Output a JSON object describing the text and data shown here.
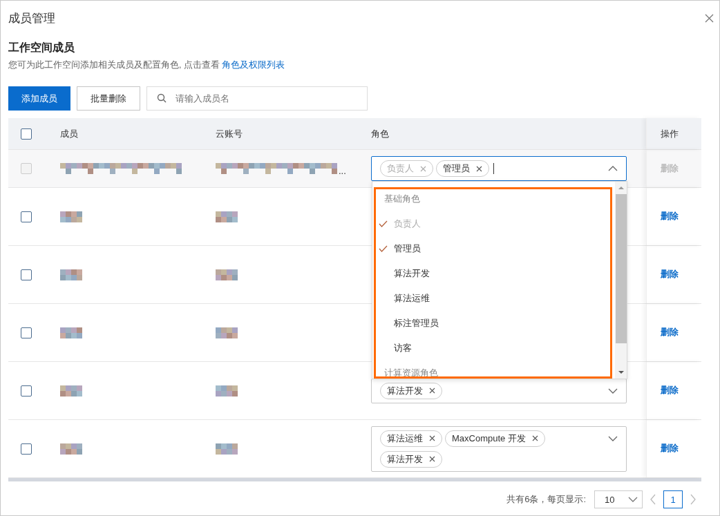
{
  "dialog": {
    "title": "成员管理"
  },
  "section": {
    "title": "工作空间成员",
    "description": "您可为此工作空间添加相关成员及配置角色, 点击查看 ",
    "link": "角色及权限列表"
  },
  "toolbar": {
    "buttons": [
      {
        "label": "添加成员",
        "kind": "primary"
      },
      {
        "label": "批量删除",
        "kind": "default"
      }
    ],
    "search": {
      "placeholder": "请输入成员名"
    }
  },
  "table": {
    "columns": [
      "成员",
      "云账号",
      "角色",
      "操作"
    ],
    "header_checked": false,
    "rows": [
      {
        "checked": false,
        "disabled": true,
        "account_suffix": "...",
        "expanded": true,
        "roles": [
          {
            "label": "负责人",
            "disabled": true
          },
          {
            "label": "管理员",
            "disabled": false
          }
        ],
        "action": "删除",
        "action_disabled": true
      },
      {
        "checked": false,
        "disabled": false,
        "action": "删除",
        "action_disabled": false
      },
      {
        "checked": false,
        "disabled": false,
        "action": "删除",
        "action_disabled": false
      },
      {
        "checked": false,
        "disabled": false,
        "action": "删除",
        "action_disabled": false
      },
      {
        "checked": false,
        "disabled": false,
        "expanded": false,
        "roles": [
          {
            "label": "算法开发",
            "disabled": false
          }
        ],
        "action": "删除",
        "action_disabled": false
      },
      {
        "checked": false,
        "disabled": false,
        "expanded": false,
        "roles": [
          {
            "label": "算法运维",
            "disabled": false
          },
          {
            "label": "MaxCompute 开发",
            "disabled": false
          },
          {
            "label": "算法开发",
            "disabled": false
          }
        ],
        "action": "删除",
        "action_disabled": false
      }
    ]
  },
  "role_dropdown": {
    "groups": [
      {
        "label": "基础角色",
        "options": [
          {
            "label": "负责人",
            "selected": true,
            "disabled": true
          },
          {
            "label": "管理员",
            "selected": true,
            "disabled": false
          },
          {
            "label": "算法开发",
            "selected": false,
            "disabled": false
          },
          {
            "label": "算法运维",
            "selected": false,
            "disabled": false
          },
          {
            "label": "标注管理员",
            "selected": false,
            "disabled": false
          },
          {
            "label": "访客",
            "selected": false,
            "disabled": false
          }
        ]
      },
      {
        "label": "计算资源角色"
      }
    ]
  },
  "pagination": {
    "summary": "共有6条，每页显示:",
    "page_size": "10",
    "pages": [
      {
        "label": "1",
        "selected": true
      }
    ]
  }
}
